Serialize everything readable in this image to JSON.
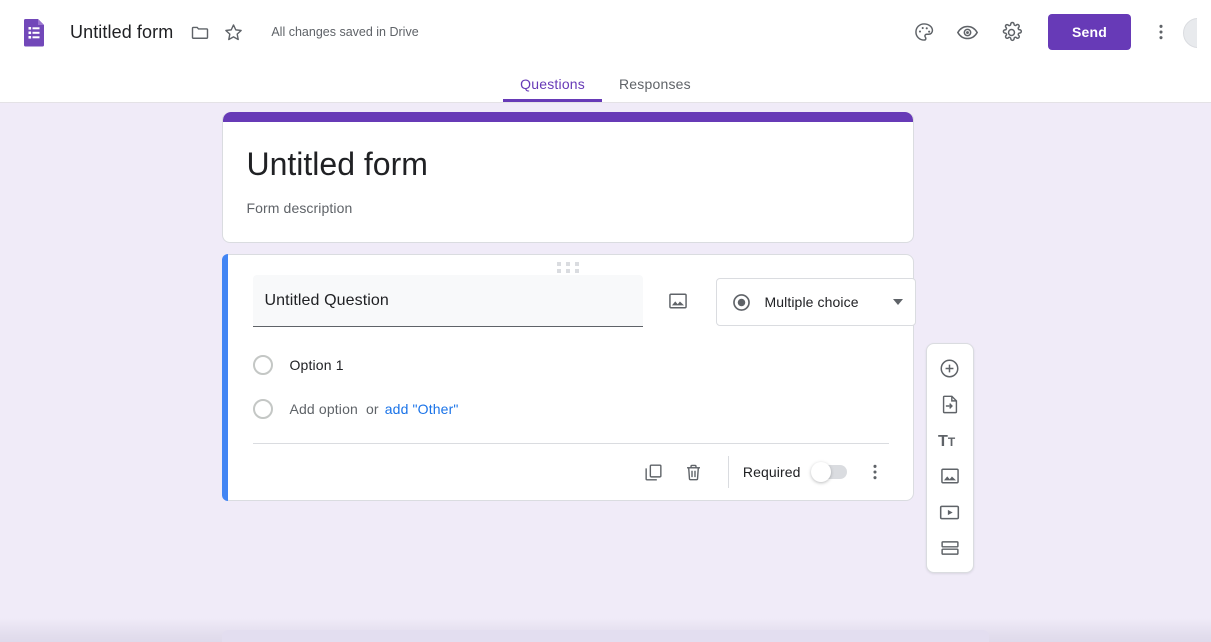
{
  "app": {
    "name": "Google Forms",
    "logo_icon": "forms-document-icon",
    "accent_purple": "#673ab7",
    "selected_blue": "#4285f4",
    "link_blue": "#1a73e8",
    "canvas_background": "#f0ebf8"
  },
  "topbar": {
    "doc_title": "Untitled form",
    "move_folder_icon": "folder-icon",
    "star_icon": "star-outline-icon",
    "save_status": "All changes saved in Drive",
    "actions": [
      {
        "name": "theme-button",
        "icon": "palette-icon",
        "tooltip": "Customize theme"
      },
      {
        "name": "preview-button",
        "icon": "eye-icon",
        "tooltip": "Preview"
      },
      {
        "name": "settings-button",
        "icon": "gear-icon",
        "tooltip": "Settings"
      }
    ],
    "send_label": "Send",
    "more_icon": "more-vertical-icon",
    "avatar_icon": "account-avatar"
  },
  "tabs": [
    {
      "label": "Questions",
      "active": true
    },
    {
      "label": "Responses",
      "active": false
    }
  ],
  "form_header": {
    "title": "Untitled form",
    "description": "Form description"
  },
  "question": {
    "drag_handle_icon": "drag-dots-icon",
    "title_value": "Untitled Question",
    "image_icon": "insert-image-icon",
    "type": {
      "icon": "radio-filled-icon",
      "label": "Multiple choice",
      "chevron_icon": "chevron-down-icon"
    },
    "options": [
      {
        "label": "Option 1",
        "radio_icon": "radio-empty-icon",
        "is_placeholder": false
      }
    ],
    "add_option": {
      "radio_icon": "radio-empty-icon",
      "label": "Add option",
      "or_text": "or",
      "add_other_label": "add \"Other\""
    },
    "footer": {
      "duplicate_icon": "duplicate-icon",
      "delete_icon": "trash-icon",
      "required_label": "Required",
      "required_on": false,
      "more_icon": "more-vertical-icon"
    }
  },
  "side_toolbar": [
    {
      "name": "add-question-button",
      "icon": "plus-circle-icon",
      "tooltip": "Add question"
    },
    {
      "name": "import-questions-button",
      "icon": "import-file-icon",
      "tooltip": "Import questions"
    },
    {
      "name": "add-title-description-button",
      "icon": "title-text-icon",
      "tooltip": "Add title and description"
    },
    {
      "name": "add-image-button",
      "icon": "image-icon",
      "tooltip": "Add image"
    },
    {
      "name": "add-video-button",
      "icon": "video-icon",
      "tooltip": "Add video"
    },
    {
      "name": "add-section-button",
      "icon": "section-icon",
      "tooltip": "Add section"
    }
  ]
}
